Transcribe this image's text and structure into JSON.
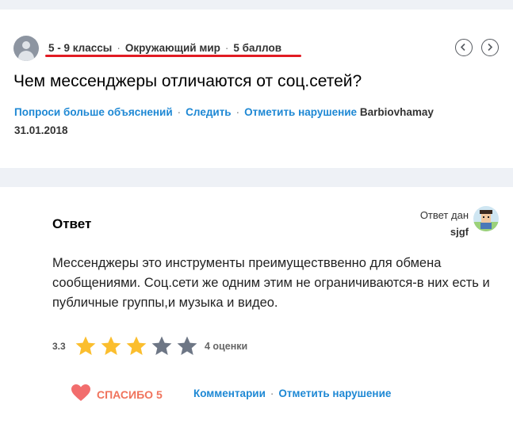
{
  "colors": {
    "link": "#1e88d4",
    "red_underline": "#e21b23",
    "star_filled": "#fbbe2e",
    "star_empty": "#6d7685",
    "heart": "#f26d6d",
    "background_band": "#eef1f6"
  },
  "question": {
    "grade": "5 - 9 классы",
    "subject": "Окружающий мир",
    "points": "5 баллов",
    "text": "Чем мессенджеры отличаются от соц.сетей?",
    "actions": {
      "ask_more": "Попроси больше объяснений",
      "follow": "Следить",
      "report": "Отметить нарушение"
    },
    "author": "Barbiovhamay",
    "date": "31.01.2018",
    "nav": {
      "prev_icon": "chevron-left-icon",
      "next_icon": "chevron-right-icon"
    }
  },
  "answer": {
    "title": "Ответ",
    "answered_by_label": "Ответ дан",
    "answered_by_user": "sjgf",
    "text": "Мессенджеры это инструменты преимуществвенно для обмена сообщениями. Соц.сети же одним этим не ограничиваются-в них есть и публичные группы,и музыка и видео.",
    "rating": {
      "value": "3.3",
      "stars_filled": 3,
      "stars_total": 5,
      "count_label": "4 оценки"
    },
    "thanks_label": "СПАСИБО 5",
    "links": {
      "comments": "Комментарии",
      "report": "Отметить нарушение"
    }
  }
}
